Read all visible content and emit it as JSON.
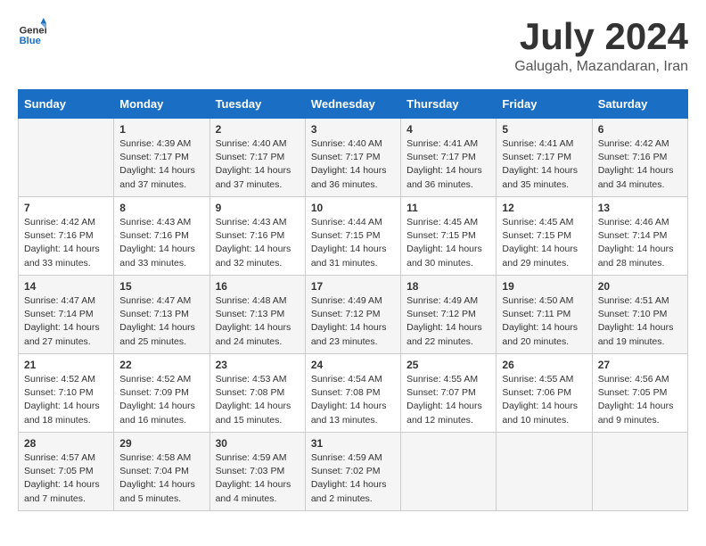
{
  "header": {
    "logo_general": "General",
    "logo_blue": "Blue",
    "month_year": "July 2024",
    "location": "Galugah, Mazandaran, Iran"
  },
  "days_of_week": [
    "Sunday",
    "Monday",
    "Tuesday",
    "Wednesday",
    "Thursday",
    "Friday",
    "Saturday"
  ],
  "weeks": [
    [
      {
        "day": "",
        "sunrise": "",
        "sunset": "",
        "daylight": ""
      },
      {
        "day": "1",
        "sunrise": "Sunrise: 4:39 AM",
        "sunset": "Sunset: 7:17 PM",
        "daylight": "Daylight: 14 hours and 37 minutes."
      },
      {
        "day": "2",
        "sunrise": "Sunrise: 4:40 AM",
        "sunset": "Sunset: 7:17 PM",
        "daylight": "Daylight: 14 hours and 37 minutes."
      },
      {
        "day": "3",
        "sunrise": "Sunrise: 4:40 AM",
        "sunset": "Sunset: 7:17 PM",
        "daylight": "Daylight: 14 hours and 36 minutes."
      },
      {
        "day": "4",
        "sunrise": "Sunrise: 4:41 AM",
        "sunset": "Sunset: 7:17 PM",
        "daylight": "Daylight: 14 hours and 36 minutes."
      },
      {
        "day": "5",
        "sunrise": "Sunrise: 4:41 AM",
        "sunset": "Sunset: 7:17 PM",
        "daylight": "Daylight: 14 hours and 35 minutes."
      },
      {
        "day": "6",
        "sunrise": "Sunrise: 4:42 AM",
        "sunset": "Sunset: 7:16 PM",
        "daylight": "Daylight: 14 hours and 34 minutes."
      }
    ],
    [
      {
        "day": "7",
        "sunrise": "Sunrise: 4:42 AM",
        "sunset": "Sunset: 7:16 PM",
        "daylight": "Daylight: 14 hours and 33 minutes."
      },
      {
        "day": "8",
        "sunrise": "Sunrise: 4:43 AM",
        "sunset": "Sunset: 7:16 PM",
        "daylight": "Daylight: 14 hours and 33 minutes."
      },
      {
        "day": "9",
        "sunrise": "Sunrise: 4:43 AM",
        "sunset": "Sunset: 7:16 PM",
        "daylight": "Daylight: 14 hours and 32 minutes."
      },
      {
        "day": "10",
        "sunrise": "Sunrise: 4:44 AM",
        "sunset": "Sunset: 7:15 PM",
        "daylight": "Daylight: 14 hours and 31 minutes."
      },
      {
        "day": "11",
        "sunrise": "Sunrise: 4:45 AM",
        "sunset": "Sunset: 7:15 PM",
        "daylight": "Daylight: 14 hours and 30 minutes."
      },
      {
        "day": "12",
        "sunrise": "Sunrise: 4:45 AM",
        "sunset": "Sunset: 7:15 PM",
        "daylight": "Daylight: 14 hours and 29 minutes."
      },
      {
        "day": "13",
        "sunrise": "Sunrise: 4:46 AM",
        "sunset": "Sunset: 7:14 PM",
        "daylight": "Daylight: 14 hours and 28 minutes."
      }
    ],
    [
      {
        "day": "14",
        "sunrise": "Sunrise: 4:47 AM",
        "sunset": "Sunset: 7:14 PM",
        "daylight": "Daylight: 14 hours and 27 minutes."
      },
      {
        "day": "15",
        "sunrise": "Sunrise: 4:47 AM",
        "sunset": "Sunset: 7:13 PM",
        "daylight": "Daylight: 14 hours and 25 minutes."
      },
      {
        "day": "16",
        "sunrise": "Sunrise: 4:48 AM",
        "sunset": "Sunset: 7:13 PM",
        "daylight": "Daylight: 14 hours and 24 minutes."
      },
      {
        "day": "17",
        "sunrise": "Sunrise: 4:49 AM",
        "sunset": "Sunset: 7:12 PM",
        "daylight": "Daylight: 14 hours and 23 minutes."
      },
      {
        "day": "18",
        "sunrise": "Sunrise: 4:49 AM",
        "sunset": "Sunset: 7:12 PM",
        "daylight": "Daylight: 14 hours and 22 minutes."
      },
      {
        "day": "19",
        "sunrise": "Sunrise: 4:50 AM",
        "sunset": "Sunset: 7:11 PM",
        "daylight": "Daylight: 14 hours and 20 minutes."
      },
      {
        "day": "20",
        "sunrise": "Sunrise: 4:51 AM",
        "sunset": "Sunset: 7:10 PM",
        "daylight": "Daylight: 14 hours and 19 minutes."
      }
    ],
    [
      {
        "day": "21",
        "sunrise": "Sunrise: 4:52 AM",
        "sunset": "Sunset: 7:10 PM",
        "daylight": "Daylight: 14 hours and 18 minutes."
      },
      {
        "day": "22",
        "sunrise": "Sunrise: 4:52 AM",
        "sunset": "Sunset: 7:09 PM",
        "daylight": "Daylight: 14 hours and 16 minutes."
      },
      {
        "day": "23",
        "sunrise": "Sunrise: 4:53 AM",
        "sunset": "Sunset: 7:08 PM",
        "daylight": "Daylight: 14 hours and 15 minutes."
      },
      {
        "day": "24",
        "sunrise": "Sunrise: 4:54 AM",
        "sunset": "Sunset: 7:08 PM",
        "daylight": "Daylight: 14 hours and 13 minutes."
      },
      {
        "day": "25",
        "sunrise": "Sunrise: 4:55 AM",
        "sunset": "Sunset: 7:07 PM",
        "daylight": "Daylight: 14 hours and 12 minutes."
      },
      {
        "day": "26",
        "sunrise": "Sunrise: 4:55 AM",
        "sunset": "Sunset: 7:06 PM",
        "daylight": "Daylight: 14 hours and 10 minutes."
      },
      {
        "day": "27",
        "sunrise": "Sunrise: 4:56 AM",
        "sunset": "Sunset: 7:05 PM",
        "daylight": "Daylight: 14 hours and 9 minutes."
      }
    ],
    [
      {
        "day": "28",
        "sunrise": "Sunrise: 4:57 AM",
        "sunset": "Sunset: 7:05 PM",
        "daylight": "Daylight: 14 hours and 7 minutes."
      },
      {
        "day": "29",
        "sunrise": "Sunrise: 4:58 AM",
        "sunset": "Sunset: 7:04 PM",
        "daylight": "Daylight: 14 hours and 5 minutes."
      },
      {
        "day": "30",
        "sunrise": "Sunrise: 4:59 AM",
        "sunset": "Sunset: 7:03 PM",
        "daylight": "Daylight: 14 hours and 4 minutes."
      },
      {
        "day": "31",
        "sunrise": "Sunrise: 4:59 AM",
        "sunset": "Sunset: 7:02 PM",
        "daylight": "Daylight: 14 hours and 2 minutes."
      },
      {
        "day": "",
        "sunrise": "",
        "sunset": "",
        "daylight": ""
      },
      {
        "day": "",
        "sunrise": "",
        "sunset": "",
        "daylight": ""
      },
      {
        "day": "",
        "sunrise": "",
        "sunset": "",
        "daylight": ""
      }
    ]
  ]
}
